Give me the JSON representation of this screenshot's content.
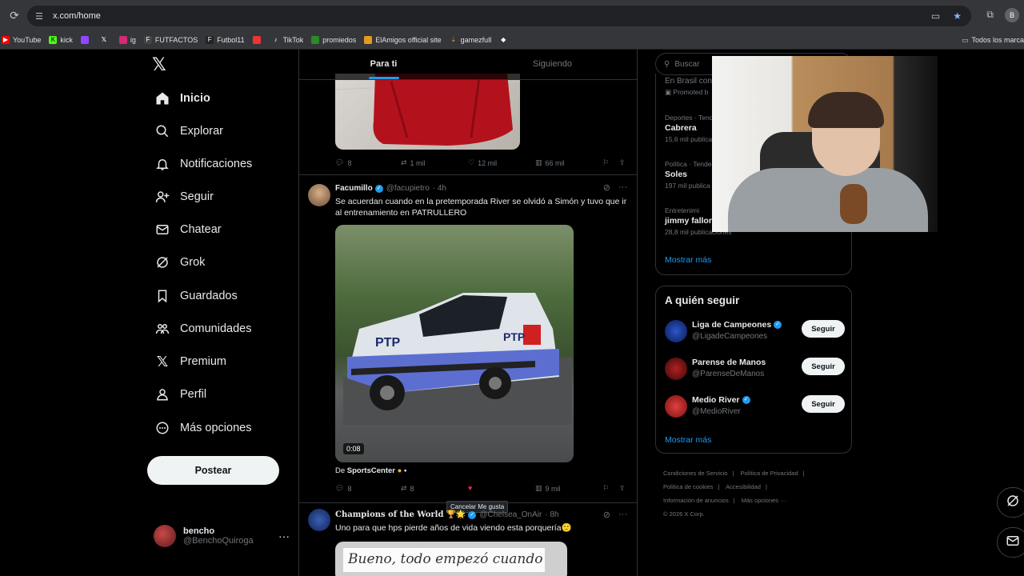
{
  "browser": {
    "url": "x.com/home",
    "profile_initial": "B",
    "bookmarks": [
      "YouTube",
      "kick",
      "",
      "",
      "ig",
      "FUTFACTOS",
      "Futbol11",
      "",
      "TikTok",
      "promiedos",
      "ElAmigos official site",
      "gamezfull",
      ""
    ],
    "all_bookmarks": "Todos los marca"
  },
  "nav": {
    "items": [
      {
        "label": "Inicio",
        "icon": "home-icon"
      },
      {
        "label": "Explorar",
        "icon": "search-icon"
      },
      {
        "label": "Notificaciones",
        "icon": "bell-icon"
      },
      {
        "label": "Seguir",
        "icon": "follow-icon"
      },
      {
        "label": "Chatear",
        "icon": "mail-icon"
      },
      {
        "label": "Grok",
        "icon": "grok-icon"
      },
      {
        "label": "Guardados",
        "icon": "bookmark-icon"
      },
      {
        "label": "Comunidades",
        "icon": "communities-icon"
      },
      {
        "label": "Premium",
        "icon": "x-icon"
      },
      {
        "label": "Perfil",
        "icon": "profile-icon"
      },
      {
        "label": "Más opciones",
        "icon": "more-icon"
      }
    ],
    "post_label": "Postear",
    "account": {
      "name": "bencho",
      "handle": "@BenchoQuiroga"
    }
  },
  "tabs": {
    "for_you": "Para ti",
    "following": "Siguiendo"
  },
  "prev_tweet_actions": {
    "replies": "8",
    "reposts": "1 mil",
    "likes": "12 mil",
    "views": "66 mil"
  },
  "tweet1": {
    "name": "Facumillo",
    "handle": "@facupietro",
    "time": "· 4h",
    "text": "Se acuerdan cuando en la pretemporada River se olvidó a Simón y tuvo que ir al entrenamiento en PATRULLERO",
    "video_time": "0:08",
    "from_prefix": "De",
    "from_source": "SportsCenter",
    "actions": {
      "replies": "8",
      "reposts": "8",
      "likes": "",
      "views": "9 mil"
    },
    "tooltip": "Cancelar Me gusta",
    "truck_label": "PTP"
  },
  "tweet2": {
    "name": "Champions of the World",
    "emojis": "🏆🌟",
    "handle": "@Chelsea_OnAir",
    "time": "· 8h",
    "text": "Uno para que hps pierde años de vida viendo esta porquería🙂",
    "media_text": "Bueno, todo empezó cuando"
  },
  "search": {
    "placeholder": "Buscar"
  },
  "trends": {
    "top_partial": "En Brasil con",
    "promoted": "Promoted b",
    "items": [
      {
        "category": "Deportes · Tende",
        "name": "Cabrera",
        "count": "15,6 mil publica"
      },
      {
        "category": "Política · Tende",
        "name": "Soles",
        "count": "197 mil publica"
      },
      {
        "category": "Entretenimi",
        "name": "jimmy fallor",
        "count": "28,8 mil publicaciones"
      }
    ],
    "show_more": "Mostrar más"
  },
  "who_to_follow": {
    "title": "A quién seguir",
    "users": [
      {
        "name": "Liga de Campeones",
        "handle": "@LigadeCampeones",
        "verified": true,
        "button": "Seguir"
      },
      {
        "name": "Parense de Manos",
        "handle": "@ParenseDeManos",
        "verified": false,
        "button": "Seguir"
      },
      {
        "name": "Medio River",
        "handle": "@MedioRiver",
        "verified": true,
        "button": "Seguir"
      }
    ],
    "show_more": "Mostrar más"
  },
  "footer": {
    "links": [
      "Condiciones de Servicio",
      "Política de Privacidad",
      "Política de cookies",
      "Accesibilidad",
      "Información de anuncios",
      "Más opciones ···"
    ],
    "copyright": "© 2026 X Corp."
  },
  "colors": {
    "accent": "#1d9bf0",
    "like": "#f91880",
    "bg": "#000000",
    "border": "#2f3336"
  }
}
